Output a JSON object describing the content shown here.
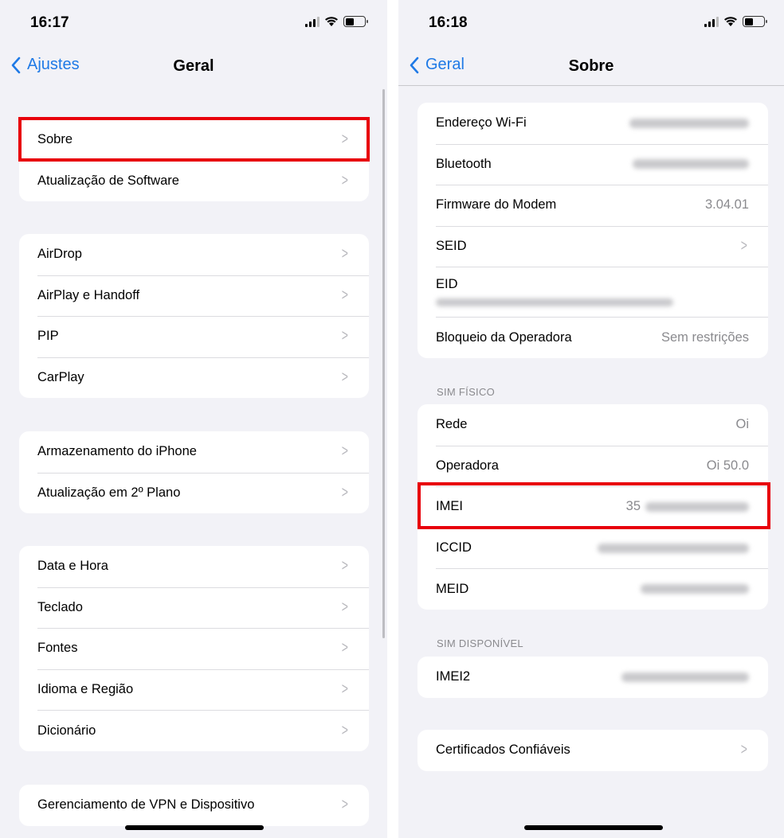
{
  "left": {
    "status_time": "16:17",
    "back_label": "Ajustes",
    "title": "Geral",
    "groups": [
      [
        {
          "label": "Sobre"
        },
        {
          "label": "Atualização de Software"
        }
      ],
      [
        {
          "label": "AirDrop"
        },
        {
          "label": "AirPlay e Handoff"
        },
        {
          "label": "PIP"
        },
        {
          "label": "CarPlay"
        }
      ],
      [
        {
          "label": "Armazenamento do iPhone"
        },
        {
          "label": "Atualização em 2º Plano"
        }
      ],
      [
        {
          "label": "Data e Hora"
        },
        {
          "label": "Teclado"
        },
        {
          "label": "Fontes"
        },
        {
          "label": "Idioma e Região"
        },
        {
          "label": "Dicionário"
        }
      ],
      [
        {
          "label": "Gerenciamento de VPN e Dispositivo"
        }
      ]
    ]
  },
  "right": {
    "status_time": "16:18",
    "back_label": "Geral",
    "title": "Sobre",
    "card1": {
      "wifi": "Endereço Wi-Fi",
      "bluetooth": "Bluetooth",
      "firmware": "Firmware do Modem",
      "firmware_value": "3.04.01",
      "seid": "SEID",
      "eid": "EID",
      "lock": "Bloqueio da Operadora",
      "lock_value": "Sem restrições"
    },
    "sim_fisico_header": "SIM FÍSICO",
    "card2": {
      "rede": "Rede",
      "rede_value": "Oi",
      "operadora": "Operadora",
      "operadora_value": "Oi 50.0",
      "imei": "IMEI",
      "imei_prefix": "35",
      "iccid": "ICCID",
      "meid": "MEID"
    },
    "sim_disponivel_header": "SIM DISPONÍVEL",
    "card3": {
      "imei2": "IMEI2"
    },
    "card4": {
      "certs": "Certificados Confiáveis"
    }
  },
  "colors": {
    "accent": "#1f7ae6",
    "highlight": "#e8000b",
    "background": "#f2f2f7"
  },
  "icons": {
    "back": "chevron-left-icon",
    "row": "chevron-right-icon",
    "signal": "cellular-signal-icon",
    "wifi": "wifi-icon",
    "battery": "battery-icon"
  }
}
